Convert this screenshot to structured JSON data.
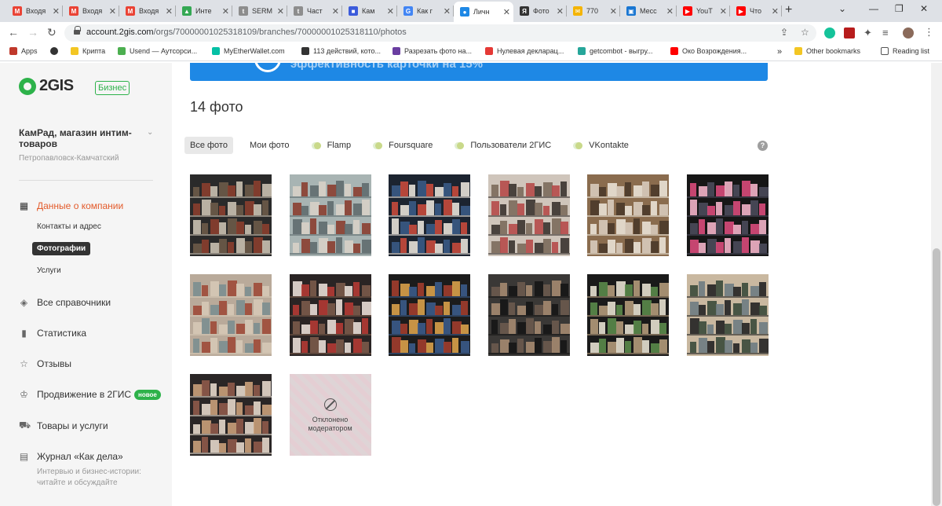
{
  "browser": {
    "tabs": [
      {
        "title": "Входя",
        "icon_color": "#ea4335",
        "icon_letter": "M"
      },
      {
        "title": "Входя",
        "icon_color": "#ea4335",
        "icon_letter": "M"
      },
      {
        "title": "Входя",
        "icon_color": "#ea4335",
        "icon_letter": "M"
      },
      {
        "title": "Инте",
        "icon_color": "#34a853",
        "icon_letter": "▲"
      },
      {
        "title": "SERM",
        "icon_color": "#8d8d8d",
        "icon_letter": "t"
      },
      {
        "title": "Част",
        "icon_color": "#8d8d8d",
        "icon_letter": "t"
      },
      {
        "title": "Кам",
        "icon_color": "#3b5bdb",
        "icon_letter": "■"
      },
      {
        "title": "Как г",
        "icon_color": "#4285f4",
        "icon_letter": "G"
      },
      {
        "title": "Личн",
        "icon_color": "#1e88e5",
        "icon_letter": "●"
      },
      {
        "title": "Фото",
        "icon_color": "#333333",
        "icon_letter": "Я"
      },
      {
        "title": "770",
        "icon_color": "#f4b400",
        "icon_letter": "✉"
      },
      {
        "title": "Месс",
        "icon_color": "#1976d2",
        "icon_letter": "▣"
      },
      {
        "title": "YouT",
        "icon_color": "#ff0000",
        "icon_letter": "▶"
      },
      {
        "title": "Что",
        "icon_color": "#ff0000",
        "icon_letter": "▶"
      }
    ],
    "active_tab": 8,
    "url_host": "account.2gis.com",
    "url_path": "/orgs/70000001025318109/branches/70000001025318110/photos",
    "bookmarks": [
      {
        "label": "Apps",
        "color": "#c0392b"
      },
      {
        "label": "",
        "color": "#333333"
      },
      {
        "label": "Крипта",
        "color": "#f3c623"
      },
      {
        "label": "Usend — Аутсорси...",
        "color": "#4caf50"
      },
      {
        "label": "MyEtherWallet.com",
        "color": "#05c0a5"
      },
      {
        "label": "113 действий, кото...",
        "color": "#333333"
      },
      {
        "label": "Разрезать фото на...",
        "color": "#6a3ea1"
      },
      {
        "label": "Нулевая декларац...",
        "color": "#e53935"
      },
      {
        "label": "getcombot - выгру...",
        "color": "#26a69a"
      },
      {
        "label": "Око Возрождения...",
        "color": "#ff0000"
      }
    ],
    "other_bookmarks": "Other bookmarks",
    "reading_list": "Reading list"
  },
  "sidebar": {
    "logo_text": "2GIS",
    "business_badge": "Бизнес",
    "company_name": "КамРад, магазин интим-товаров",
    "city": "Петропавловск-Камчатский",
    "menu": [
      {
        "label": "Данные о компании",
        "icon": "grid-icon",
        "active": true
      },
      {
        "label": "Все справочники",
        "icon": "layers-icon"
      },
      {
        "label": "Статистика",
        "icon": "bar-chart-icon"
      },
      {
        "label": "Отзывы",
        "icon": "star-icon"
      },
      {
        "label": "Продвижение в 2ГИС",
        "icon": "crown-icon",
        "badge": "новое"
      },
      {
        "label": "Товары и услуги",
        "icon": "cart-icon"
      },
      {
        "label": "Журнал «Как дела»",
        "icon": "book-icon",
        "description": "Интервью и бизнес-истории: читайте и обсуждайте"
      }
    ],
    "submenu": [
      {
        "label": "Контакты и адрес"
      },
      {
        "label": "Фотографии",
        "active": true
      },
      {
        "label": "Услуги"
      }
    ]
  },
  "main": {
    "banner_text": "эффективность карточки на 15%",
    "photo_count": "14 фото",
    "filters": [
      {
        "label": "Все фото",
        "active": true,
        "toggle": false
      },
      {
        "label": "Мои фото",
        "active": false,
        "toggle": false
      },
      {
        "label": "Flamp",
        "active": false,
        "toggle": true
      },
      {
        "label": "Foursquare",
        "active": false,
        "toggle": true
      },
      {
        "label": "Пользователи 2ГИС",
        "active": false,
        "toggle": true
      },
      {
        "label": "VKontakte",
        "active": false,
        "toggle": true
      }
    ],
    "help": "?",
    "rejected_text": "Отклонено модератором",
    "photos": [
      {
        "palette": [
          "#2a2a2a",
          "#6b5a48",
          "#8a3e2e",
          "#c9c0b0"
        ]
      },
      {
        "palette": [
          "#a8b4b3",
          "#d7d0c6",
          "#8a3e30",
          "#5f6c6e"
        ]
      },
      {
        "palette": [
          "#1c2430",
          "#3a5a85",
          "#c74a3c",
          "#e7e1d8"
        ]
      },
      {
        "palette": [
          "#cfc5bb",
          "#7b6a5c",
          "#b54a4a",
          "#3a3330"
        ]
      },
      {
        "palette": [
          "#8a6c4e",
          "#d7cbbd",
          "#4a3a2a",
          "#e9e2d6"
        ]
      },
      {
        "palette": [
          "#161616",
          "#d84a7a",
          "#f2b3c8",
          "#4a4a5a"
        ]
      },
      {
        "palette": [
          "#b9aa9a",
          "#7c8e90",
          "#9e4a38",
          "#d6c8b6"
        ]
      },
      {
        "palette": [
          "#2a2424",
          "#e8ddd6",
          "#b33a34",
          "#7a5a4a"
        ]
      },
      {
        "palette": [
          "#1c1c1c",
          "#a13d2d",
          "#d9a14a",
          "#3b5b8a"
        ]
      },
      {
        "palette": [
          "#3a3836",
          "#6b5a4e",
          "#a58a70",
          "#161616"
        ]
      },
      {
        "palette": [
          "#1a1a1a",
          "#e6e0d0",
          "#5a8a4a",
          "#b39a7a"
        ]
      },
      {
        "palette": [
          "#c9b8a0",
          "#3a4a3a",
          "#6e7c82",
          "#232323"
        ]
      },
      {
        "palette": [
          "#2a2626",
          "#c9a07a",
          "#8e5a4a",
          "#e3d7ca"
        ]
      },
      {
        "palette": [
          "#e6c6cf",
          "#d9a8b3",
          "#f3e6ea",
          "#c98f9e"
        ],
        "rejected": true
      }
    ]
  }
}
